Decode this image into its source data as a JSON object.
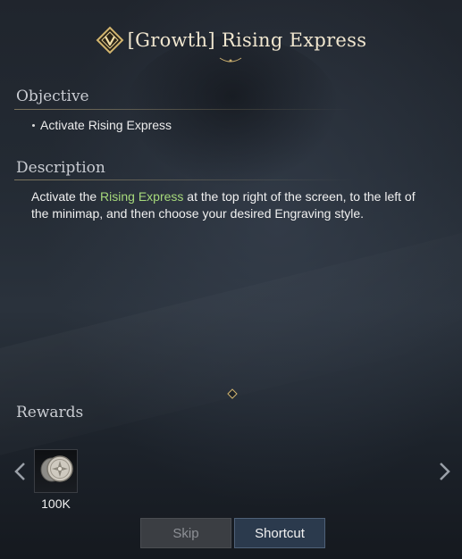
{
  "quest": {
    "title": "[Growth] Rising Express",
    "title_icon": "quest-diamond-emblem-icon"
  },
  "objective": {
    "label": "Objective",
    "items": [
      "Activate Rising Express"
    ]
  },
  "description": {
    "label": "Description",
    "text_before": "Activate the ",
    "highlight": "Rising Express",
    "text_after": " at the top right of the screen, to the left of the minimap, and then choose your desired Engraving style.",
    "highlight_color": "#a6d97b"
  },
  "rewards": {
    "label": "Rewards",
    "items": [
      {
        "icon": "silver-coin-icon",
        "amount": "100K"
      }
    ],
    "prev_icon": "chevron-left-icon",
    "next_icon": "chevron-right-icon"
  },
  "buttons": {
    "skip": "Skip",
    "shortcut": "Shortcut"
  },
  "colors": {
    "accent_gold": "#c8ad6e",
    "title_text": "#f0e6cf",
    "background": "#1b2029"
  }
}
